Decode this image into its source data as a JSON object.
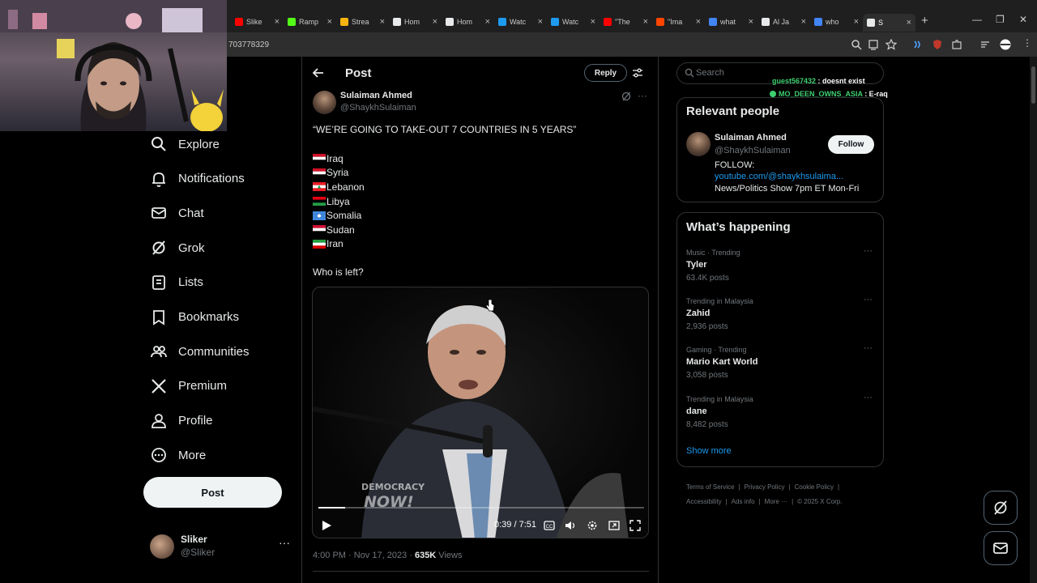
{
  "browser": {
    "tabs": [
      {
        "label": "Slike",
        "color": "#ff0000"
      },
      {
        "label": "Ramp",
        "color": "#53fc18"
      },
      {
        "label": "Strea",
        "color": "#f6b40e"
      },
      {
        "label": "Hom",
        "color": "#e7e9ea"
      },
      {
        "label": "Hom",
        "color": "#e7e9ea"
      },
      {
        "label": "Watc",
        "color": "#1d9bf0"
      },
      {
        "label": "Watc",
        "color": "#1d9bf0"
      },
      {
        "label": "\"The",
        "color": "#ff0000"
      },
      {
        "label": "\"Ima",
        "color": "#ff4500"
      },
      {
        "label": "what",
        "color": "#4285f4"
      },
      {
        "label": "Al Ja",
        "color": "#e7e9ea"
      },
      {
        "label": "who",
        "color": "#4285f4"
      },
      {
        "label": "S",
        "color": "#e7e9ea"
      }
    ],
    "new_tab": "+",
    "url": "703778329"
  },
  "nav": {
    "items": [
      {
        "label": "Explore",
        "icon": "search-icon"
      },
      {
        "label": "Notifications",
        "icon": "bell-icon"
      },
      {
        "label": "Chat",
        "icon": "mail-icon"
      },
      {
        "label": "Grok",
        "icon": "grok-icon"
      },
      {
        "label": "Lists",
        "icon": "list-icon"
      },
      {
        "label": "Bookmarks",
        "icon": "bookmark-icon"
      },
      {
        "label": "Communities",
        "icon": "communities-icon"
      },
      {
        "label": "Premium",
        "icon": "x-logo-icon"
      },
      {
        "label": "Profile",
        "icon": "profile-icon"
      },
      {
        "label": "More",
        "icon": "more-circle-icon"
      }
    ],
    "post_button": "Post",
    "account": {
      "name": "Sliker",
      "handle": "@Sliker",
      "more": "···"
    }
  },
  "post": {
    "page_title": "Post",
    "reply_label": "Reply",
    "author_name": "Sulaiman Ahmed",
    "author_handle": "@ShaykhSulaiman",
    "more": "···",
    "headline": "“WE’RE GOING TO TAKE-OUT 7 COUNTRIES IN 5 YEARS”",
    "countries": [
      "Iraq",
      "Syria",
      "Lebanon",
      "Libya",
      "Somalia",
      "Sudan",
      "Iran"
    ],
    "question": "Who is left?",
    "video": {
      "time": "0:39 / 7:51",
      "progress": 0.083,
      "watermark_top": "DEMOCRACY",
      "watermark_bottom": "NOW!"
    },
    "timestamp": "4:00 PM · Nov 17, 2023 · ",
    "views_count": "635K",
    "views_label": " Views"
  },
  "sidebar": {
    "search_placeholder": "Search",
    "chat_overlay": [
      {
        "user": "guest567432",
        "message": " : doesnt exist"
      },
      {
        "user": "MO_DEEN_OWNS_ASIA",
        "message": " : E-raq"
      }
    ],
    "relevant": {
      "title": "Relevant people",
      "name": "Sulaiman Ahmed",
      "handle": "@ShaykhSulaiman",
      "follow": "Follow",
      "bio_line1": "FOLLOW:",
      "bio_link": "youtube.com/@shaykhsulaima...",
      "bio_line2": "News/Politics Show 7pm ET Mon-Fri"
    },
    "happening": {
      "title": "What’s happening",
      "trends": [
        {
          "category": "Music · Trending",
          "name": "Tyler",
          "count": "63.4K posts"
        },
        {
          "category": "Trending in Malaysia",
          "name": "Zahid",
          "count": "2,936 posts"
        },
        {
          "category": "Gaming · Trending",
          "name": "Mario Kart World",
          "count": "3,058 posts"
        },
        {
          "category": "Trending in Malaysia",
          "name": "dane",
          "count": "8,482 posts"
        }
      ],
      "show_more": "Show more"
    },
    "footer": {
      "terms": "Terms of Service",
      "privacy": "Privacy Policy",
      "cookie": "Cookie Policy",
      "accessibility": "Accessibility",
      "ads": "Ads info",
      "more": "More ···",
      "copyright": "© 2025 X Corp."
    }
  }
}
